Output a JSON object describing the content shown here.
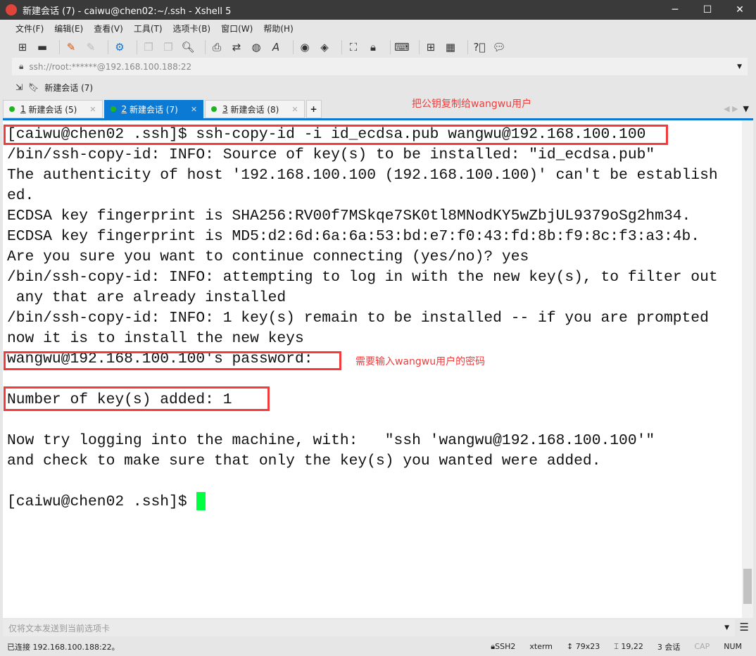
{
  "window": {
    "title": "新建会话 (7) - caiwu@chen02:~/.ssh - Xshell 5"
  },
  "menu": [
    "文件(F)",
    "编辑(E)",
    "查看(V)",
    "工具(T)",
    "选项卡(B)",
    "窗口(W)",
    "帮助(H)"
  ],
  "toolbar_icons": [
    "new-session-icon",
    "open-folder-icon",
    "connect-icon",
    "disconnect-icon",
    "properties-icon",
    "copy-icon",
    "paste-icon",
    "find-icon",
    "print-icon",
    "transfer-icon",
    "globe-icon",
    "font-icon",
    "xftp-icon",
    "xmanager-icon",
    "fullscreen-icon",
    "lock-icon",
    "keyboard-icon",
    "new-tab-icon",
    "layout-icon",
    "help-icon",
    "chat-icon"
  ],
  "address": {
    "value": "ssh://root:******@192.168.100.188:22"
  },
  "session_bar": {
    "label": "新建会话 (7)"
  },
  "tabs": [
    {
      "num": "1",
      "label": "新建会话 (5)",
      "active": false
    },
    {
      "num": "2",
      "label": "新建会话 (7)",
      "active": true
    },
    {
      "num": "3",
      "label": "新建会话 (8)",
      "active": false
    }
  ],
  "annotations": {
    "top": "把公钥复制给wangwu用户",
    "password": "需要输入wangwu用户的密码"
  },
  "terminal": {
    "lines": [
      "[caiwu@chen02 .ssh]$ ssh-copy-id -i id_ecdsa.pub wangwu@192.168.100.100",
      "/bin/ssh-copy-id: INFO: Source of key(s) to be installed: \"id_ecdsa.pub\"",
      "The authenticity of host '192.168.100.100 (192.168.100.100)' can't be establish",
      "ed.",
      "ECDSA key fingerprint is SHA256:RV00f7MSkqe7SK0tl8MNodKY5wZbjUL9379oSg2hm34.",
      "ECDSA key fingerprint is MD5:d2:6d:6a:6a:53:bd:e7:f0:43:fd:8b:f9:8c:f3:a3:4b.",
      "Are you sure you want to continue connecting (yes/no)? yes",
      "/bin/ssh-copy-id: INFO: attempting to log in with the new key(s), to filter out",
      " any that are already installed",
      "/bin/ssh-copy-id: INFO: 1 key(s) remain to be installed -- if you are prompted",
      "now it is to install the new keys",
      "wangwu@192.168.100.100's password: ",
      "",
      "Number of key(s) added: 1",
      "",
      "Now try logging into the machine, with:   \"ssh 'wangwu@192.168.100.100'\"",
      "and check to make sure that only the key(s) you wanted were added.",
      "",
      "[caiwu@chen02 .ssh]$ "
    ],
    "cursor_color": "#00ff40"
  },
  "input_bar": {
    "placeholder": "仅将文本发送到当前选项卡"
  },
  "status": {
    "connection": "已连接 192.168.100.188:22。",
    "protocol": "SSH2",
    "term": "xterm",
    "size": "79x23",
    "cursor": "19,22",
    "sessions": "3 会话",
    "cap": "CAP",
    "num": "NUM"
  },
  "colors": {
    "accent": "#0a7ad5",
    "annotation": "#f23b3b",
    "session_dot": "#1fb51f"
  }
}
